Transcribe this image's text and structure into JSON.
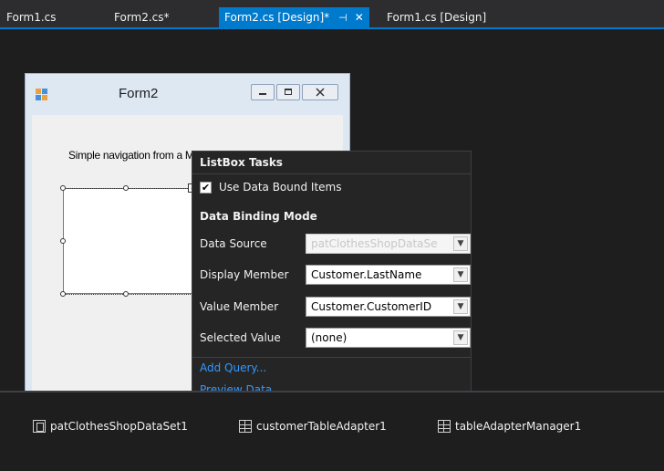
{
  "tabs": [
    {
      "label": "Form1.cs",
      "active": false
    },
    {
      "label": "Form2.cs*",
      "active": false
    },
    {
      "label": "Form2.cs [Design]*",
      "active": true
    },
    {
      "label": "Form1.cs [Design]",
      "active": false
    }
  ],
  "tab_icons": {
    "pin": "pin-icon",
    "close": "close-icon"
  },
  "form": {
    "title": "Form2",
    "description": "Simple navigation from a Master to the Detail"
  },
  "tasks": {
    "title": "ListBox Tasks",
    "use_data_bound_items": {
      "label": "Use Data Bound Items",
      "checked": true
    },
    "mode_title": "Data Binding Mode",
    "properties": [
      {
        "label": "Data Source",
        "value": "patClothesShopDataSe",
        "enabled": false
      },
      {
        "label": "Display Member",
        "value": "Customer.LastName",
        "enabled": true
      },
      {
        "label": "Value Member",
        "value": "Customer.CustomerID",
        "enabled": true
      },
      {
        "label": "Selected Value",
        "value": "(none)",
        "enabled": true
      }
    ],
    "links": [
      "Add Query...",
      "Preview Data..."
    ]
  },
  "tray": [
    {
      "label": "patClothesShopDataSet1",
      "icon": "dataset-icon"
    },
    {
      "label": "customerTableAdapter1",
      "icon": "table-adapter-icon"
    },
    {
      "label": "tableAdapterManager1",
      "icon": "table-adapter-icon"
    }
  ],
  "colors": {
    "accent": "#007acc",
    "background": "#1e1e1e",
    "link": "#3399ff"
  }
}
